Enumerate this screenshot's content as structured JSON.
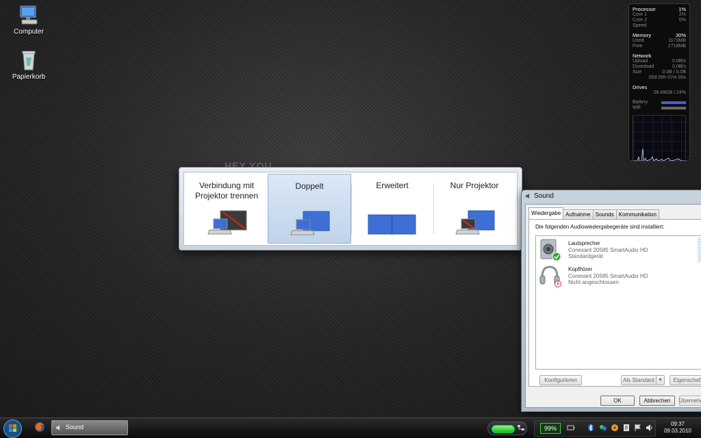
{
  "desktop": {
    "icons": [
      {
        "label": "Computer"
      },
      {
        "label": "Papierkorb"
      }
    ],
    "wallpaper_text": "HEY YOU"
  },
  "gadget": {
    "processor": {
      "label": "Processor",
      "value": "1%",
      "cores": [
        {
          "label": "Core 1",
          "value": "2%"
        },
        {
          "label": "Core 2",
          "value": "0%"
        }
      ],
      "speed_label": "Speed"
    },
    "memory": {
      "label": "Memory",
      "value": "30%",
      "used_label": "Used",
      "used": "1173MB",
      "free_label": "Free",
      "free": "2718MB"
    },
    "network": {
      "label": "Network",
      "upload_label": "Upload",
      "upload": "0.0B/s",
      "download_label": "Download",
      "download": "0.0B/s",
      "size_label": "Size",
      "size": "0.0B / 0.0B",
      "uptime": "00d 00h 07m 00s"
    },
    "drives": {
      "label": "Drives",
      "value": "28.49GB / 24%"
    },
    "battery_label": "Battery",
    "wifi_label": "Wifi"
  },
  "projector": {
    "options": [
      {
        "label_line1": "Verbindung mit",
        "label_line2": "Projektor trennen"
      },
      {
        "label_line1": "Doppelt",
        "label_line2": ""
      },
      {
        "label_line1": "Erweitert",
        "label_line2": ""
      },
      {
        "label_line1": "Nur Projektor",
        "label_line2": ""
      }
    ],
    "selected_index": 1
  },
  "sound_dialog": {
    "title": "Sound",
    "tabs": [
      "Wiedergabe",
      "Aufnahme",
      "Sounds",
      "Kommunikation"
    ],
    "active_tab": 0,
    "description": "Die folgenden Audiowiedergabegeräte sind installiert:",
    "devices": [
      {
        "name": "Lautsprecher",
        "driver": "Conexant 20585 SmartAudio HD",
        "status": "Standardgerät"
      },
      {
        "name": "Kopfhörer",
        "driver": "Conexant 20585 SmartAudio HD",
        "status": "Nicht angeschlossen"
      }
    ],
    "buttons": {
      "configure": "Konfigurieren",
      "set_default": "Als Standard",
      "properties": "Eigenschaften",
      "ok": "OK",
      "cancel": "Abbrechen",
      "apply": "Übernehmen"
    }
  },
  "taskbar": {
    "window_button": "Sound",
    "battery_percent": "99%",
    "time": "09:37",
    "date": "09.03.2010"
  },
  "colors": {
    "accent_blue": "#3d6fd6",
    "battery_green": "#2ecc40",
    "projector_selected": "#c9daee"
  }
}
